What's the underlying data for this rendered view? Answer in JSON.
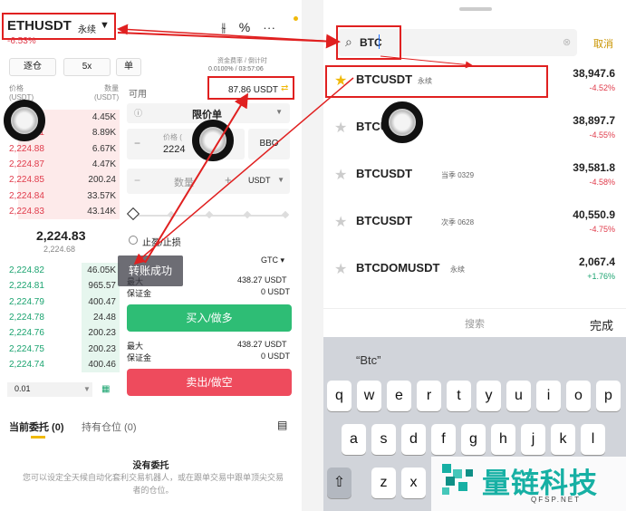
{
  "left": {
    "symbol": "ETHUSDT",
    "contract_type": "永续",
    "change": "-6.53%",
    "leverage_options": [
      "逐仓",
      "5x",
      "单"
    ],
    "funding_label": "资金费率 / 倒计时",
    "funding_value": "0.0100% / 03:57:06",
    "orderbook_header": {
      "price": "价格\n(USDT)",
      "qty": "数量\n(USDT)"
    },
    "asks": [
      {
        "price": "2,224.93",
        "qty": "4.45K"
      },
      {
        "price": "2,224.91",
        "qty": "8.89K"
      },
      {
        "price": "2,224.88",
        "qty": "6.67K"
      },
      {
        "price": "2,224.87",
        "qty": "4.47K"
      },
      {
        "price": "2,224.85",
        "qty": "200.24"
      },
      {
        "price": "2,224.84",
        "qty": "33.57K"
      },
      {
        "price": "2,224.83",
        "qty": "43.14K"
      }
    ],
    "last_price": "2,224.83",
    "mark_price": "2,224.68",
    "bids": [
      {
        "price": "2,224.82",
        "qty": "46.05K"
      },
      {
        "price": "2,224.81",
        "qty": "965.57"
      },
      {
        "price": "2,224.79",
        "qty": "400.47"
      },
      {
        "price": "2,224.78",
        "qty": "24.48"
      },
      {
        "price": "2,224.76",
        "qty": "200.23"
      },
      {
        "price": "2,224.75",
        "qty": "200.23"
      },
      {
        "price": "2,224.74",
        "qty": "400.46"
      }
    ],
    "precision": "0.01",
    "available_label": "可用",
    "available_value": "87.86 USDT",
    "order_type": "限价单",
    "price_label": "价格 (",
    "price_value": "2224",
    "bbo": "BBO",
    "qty_label": "数量",
    "qty_unit": "USDT",
    "tpsl": "止盈/止损",
    "tif": "GTC",
    "toast": "转账成功",
    "max1_label": "最大",
    "max1_value": "438.27 USDT",
    "margin1_label": "保证金",
    "margin1_value": "0 USDT",
    "buy_label": "买入/做多",
    "max2_label": "最大",
    "max2_value": "438.27 USDT",
    "margin2_label": "保证金",
    "margin2_value": "0 USDT",
    "sell_label": "卖出/做空",
    "tab_orders": "当前委托 (0)",
    "tab_positions": "持有仓位 (0)",
    "empty_title": "没有委托",
    "empty_desc": "您可以设定全天候自动化套利交易机器人，或在跟单交易中跟单顶尖交易者的仓位。"
  },
  "right": {
    "search_value": "BTC",
    "cancel": "取消",
    "results": [
      {
        "name": "BTCUSDT",
        "tag": "永续",
        "price": "38,947.6",
        "change": "-4.52%",
        "fav": true,
        "dir": "neg"
      },
      {
        "name": "BTCU",
        "tag": "",
        "price": "38,897.7",
        "change": "-4.55%",
        "fav": false,
        "dir": "neg"
      },
      {
        "name": "BTCUSDT",
        "tag": "当季 0329",
        "price": "39,581.8",
        "change": "-4.58%",
        "fav": false,
        "dir": "neg"
      },
      {
        "name": "BTCUSDT",
        "tag": "次季 0628",
        "price": "40,550.9",
        "change": "-4.75%",
        "fav": false,
        "dir": "neg"
      },
      {
        "name": "BTCDOMUSDT",
        "tag": "永续",
        "price": "2,067.4",
        "change": "+1.76%",
        "fav": false,
        "dir": "pos"
      }
    ],
    "kbd_search": "搜索",
    "kbd_done": "完成",
    "suggestion": "“Btc”",
    "row1": [
      "q",
      "w",
      "e",
      "r",
      "t",
      "y",
      "u",
      "i",
      "o",
      "p"
    ],
    "row2": [
      "a",
      "s",
      "d",
      "f",
      "g",
      "h",
      "j",
      "k",
      "l"
    ],
    "row3": [
      "z",
      "x"
    ]
  },
  "watermark": {
    "title": "量链科技",
    "sub": "QFSP.NET"
  }
}
